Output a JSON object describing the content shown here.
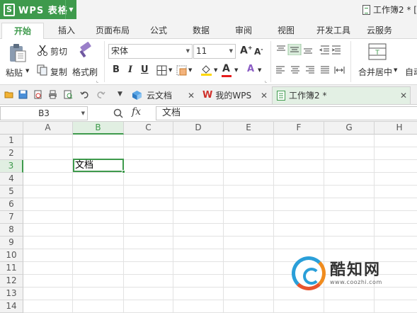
{
  "titlebar": {
    "app_name": "WPS 表格",
    "logo_letter": "S",
    "doc_title": "工作簿2 * ["
  },
  "menu_tabs": [
    "开始",
    "插入",
    "页面布局",
    "公式",
    "数据",
    "审阅",
    "视图",
    "开发工具",
    "云服务"
  ],
  "ribbon": {
    "paste_label": "粘贴",
    "cut_label": "剪切",
    "copy_label": "复制",
    "format_painter_label": "格式刷",
    "font_name": "宋体",
    "font_size": "11",
    "bold": "B",
    "italic": "I",
    "underline": "U",
    "merge_center_label": "合并居中",
    "auto_wrap_label": "自动"
  },
  "doc_tabs": {
    "cloud_docs": "云文档",
    "my_wps": "我的WPS",
    "workbook": "工作簿2 *"
  },
  "formula_bar": {
    "name_box": "B3",
    "fx_label": "fx",
    "value": "文档"
  },
  "grid": {
    "columns": [
      "A",
      "B",
      "C",
      "D",
      "E",
      "F",
      "G",
      "H"
    ],
    "selected_column": "B",
    "rows": [
      "1",
      "2",
      "3",
      "4",
      "5",
      "6",
      "7",
      "8",
      "9",
      "10",
      "11",
      "12",
      "13",
      "14"
    ],
    "selected_row": "3",
    "active_cell": {
      "ref": "B3",
      "value": "文档"
    }
  },
  "watermark": {
    "title": "酷知网",
    "url": "www.coozhi.com"
  },
  "colors": {
    "accent_green": "#3e9a4c",
    "selected_header_bg": "#e1efe2"
  }
}
